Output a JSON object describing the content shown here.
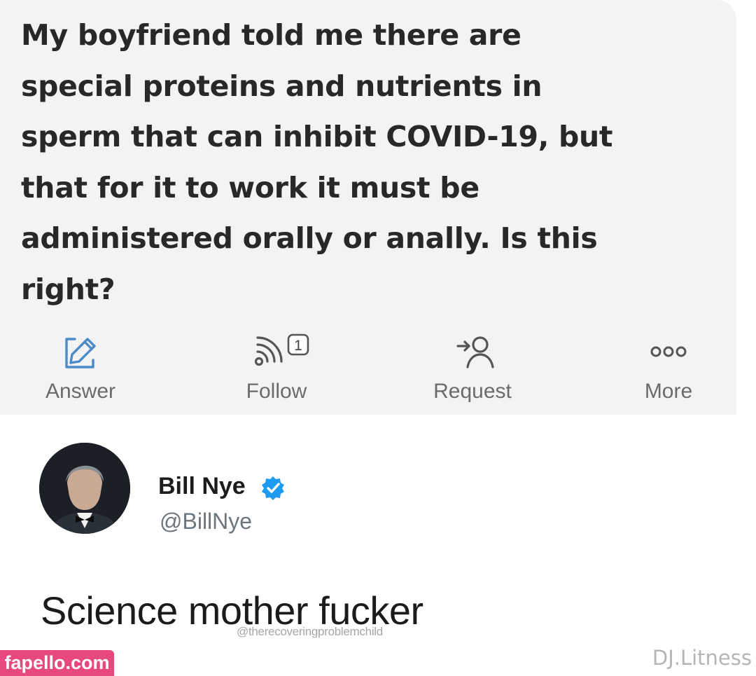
{
  "question": {
    "lines": [
      "My boyfriend told me there are",
      "special proteins and nutrients in",
      "sperm that can inhibit COVID-19, but",
      "that for it to work it must be",
      "administered orally or anally. Is this",
      "right?"
    ]
  },
  "actions": [
    {
      "label": "Answer",
      "icon": "pencil-square-icon"
    },
    {
      "label": "Follow",
      "icon": "rss-icon",
      "badge": "1"
    },
    {
      "label": "Request",
      "icon": "person-arrow-icon"
    },
    {
      "label": "More",
      "icon": "more-dots-icon"
    }
  ],
  "tweet": {
    "display_name": "Bill Nye",
    "handle": "@BillNye",
    "verified": true,
    "text": "Science mother fucker",
    "watermark": "@therecoveringproblemchild"
  },
  "branding": {
    "left": "fapello.com",
    "right": "DJ.Litness"
  },
  "colors": {
    "card_bg": "#f3f3f3",
    "icon_blue": "#4a8ac8",
    "verified_blue": "#1d9bf0",
    "brand_pink": "#e8497d"
  }
}
